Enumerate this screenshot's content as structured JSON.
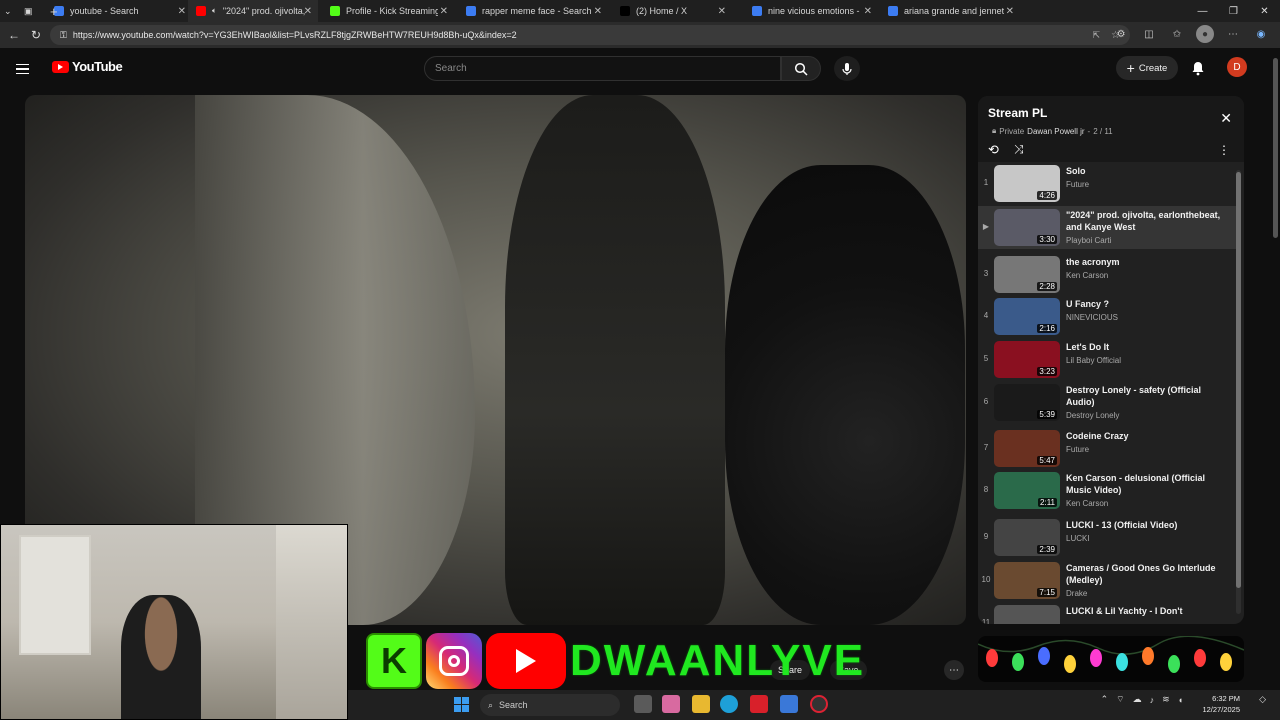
{
  "browser": {
    "tabs": [
      {
        "label": "youtube - Search",
        "favicon_color": "#3c7cf2",
        "active": false
      },
      {
        "label": "\"2024\" prod. ojivolta,",
        "favicon_color": "#ff0000",
        "active": true,
        "muted_icon": "speaker-icon"
      },
      {
        "label": "Profile - Kick Streaming",
        "favicon_color": "#53fc18",
        "active": false
      },
      {
        "label": "rapper meme face - Search",
        "favicon_color": "#3c7cf2",
        "active": false
      },
      {
        "label": "(2) Home / X",
        "favicon_color": "#000000",
        "active": false
      },
      {
        "label": "nine vicious emotions - Se",
        "favicon_color": "#3c7cf2",
        "active": false
      },
      {
        "label": "ariana grande and jennett",
        "favicon_color": "#3c7cf2",
        "active": false
      }
    ],
    "url": "https://www.youtube.com/watch?v=YG3EhWIBaol&list=PLvsRZLF8tjgZRWBeHTW7REUH9d8Bh-uQx&index=2"
  },
  "youtube": {
    "logo_text": "YouTube",
    "search_placeholder": "Search",
    "create_label": "Create",
    "avatar_letter": "D",
    "brand_color": "#ff0000"
  },
  "playlist": {
    "title": "Stream PL",
    "privacy": "Private",
    "owner": "Dawan Powell jr",
    "position": "2 / 11",
    "items": [
      {
        "index": "1",
        "title": "Solo",
        "channel": "Future",
        "duration": "4:26",
        "thumb": "#c7c7c7",
        "current": false
      },
      {
        "index": "▶",
        "title": "\"2024\" prod. ojivolta, earlonthebeat, and Kanye West",
        "channel": "Playboi Carti",
        "duration": "3:30",
        "thumb": "#5a5a66",
        "current": true
      },
      {
        "index": "3",
        "title": "the acronym",
        "channel": "Ken Carson",
        "duration": "2:28",
        "thumb": "#777",
        "current": false
      },
      {
        "index": "4",
        "title": "U Fancy ?",
        "channel": "NINEVICIOUS",
        "duration": "2:16",
        "thumb": "#3a5a8a",
        "current": false
      },
      {
        "index": "5",
        "title": "Let's Do It",
        "channel": "Lil Baby Official",
        "duration": "3:23",
        "thumb": "#8a1020",
        "current": false
      },
      {
        "index": "6",
        "title": "Destroy Lonely - safety (Official Audio)",
        "channel": "Destroy Lonely",
        "duration": "5:39",
        "thumb": "#1a1a1a",
        "current": false
      },
      {
        "index": "7",
        "title": "Codeine Crazy",
        "channel": "Future",
        "duration": "5:47",
        "thumb": "#6a3020",
        "current": false
      },
      {
        "index": "8",
        "title": "Ken Carson - delusional (Official Music Video)",
        "channel": "Ken Carson",
        "duration": "2:11",
        "thumb": "#2a6a4a",
        "current": false
      },
      {
        "index": "9",
        "title": "LUCKI - 13 (Official Video)",
        "channel": "LUCKI",
        "duration": "2:39",
        "thumb": "#444",
        "current": false
      },
      {
        "index": "10",
        "title": "Cameras / Good Ones Go Interlude (Medley)",
        "channel": "Drake",
        "duration": "7:15",
        "thumb": "#6a4a30",
        "current": false
      },
      {
        "index": "11",
        "title": "LUCKI & Lil Yachty - I Don't",
        "channel": "",
        "duration": "",
        "thumb": "#555",
        "current": false
      }
    ]
  },
  "overlay": {
    "kick_letter": "K",
    "channel_name": "DWAANLYVE",
    "kick_color": "#53fc18",
    "name_color": "#20e820"
  },
  "video_actions": {
    "share_label": "Share",
    "save_label": "Save"
  },
  "taskbar": {
    "search_label": "Search",
    "time": "6:32 PM",
    "date": "12/27/2025"
  }
}
